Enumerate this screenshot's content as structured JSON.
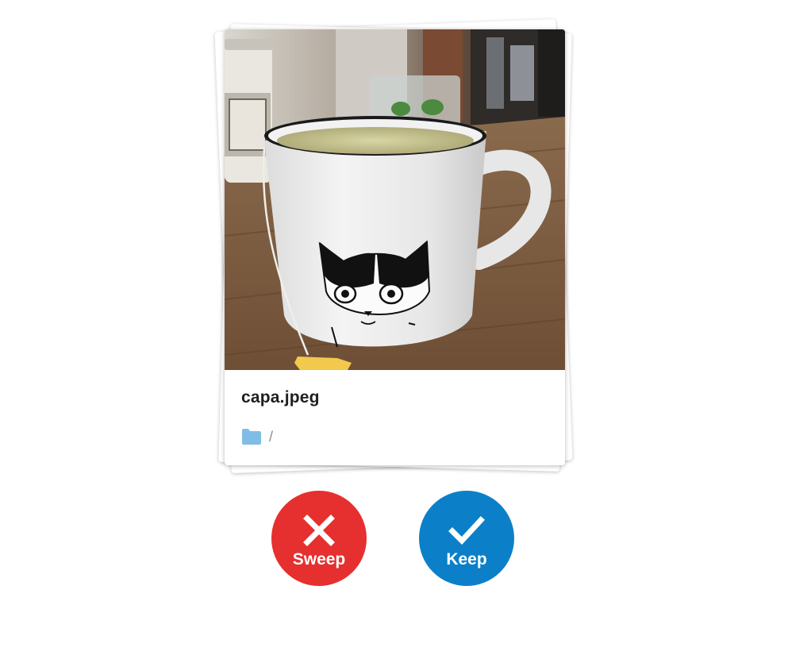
{
  "card": {
    "file_name": "capa.jpeg",
    "folder_icon": "folder-icon",
    "path": "/",
    "photo_description_icon": "photo-thumbnail"
  },
  "actions": {
    "sweep_label": "Sweep",
    "sweep_icon": "close-icon",
    "sweep_color": "#e5302f",
    "keep_label": "Keep",
    "keep_icon": "check-icon",
    "keep_color": "#0b80c9"
  },
  "colors": {
    "folder": "#7fbde6",
    "path_text": "#8a8a8a",
    "file_name": "#1f1f1f"
  }
}
